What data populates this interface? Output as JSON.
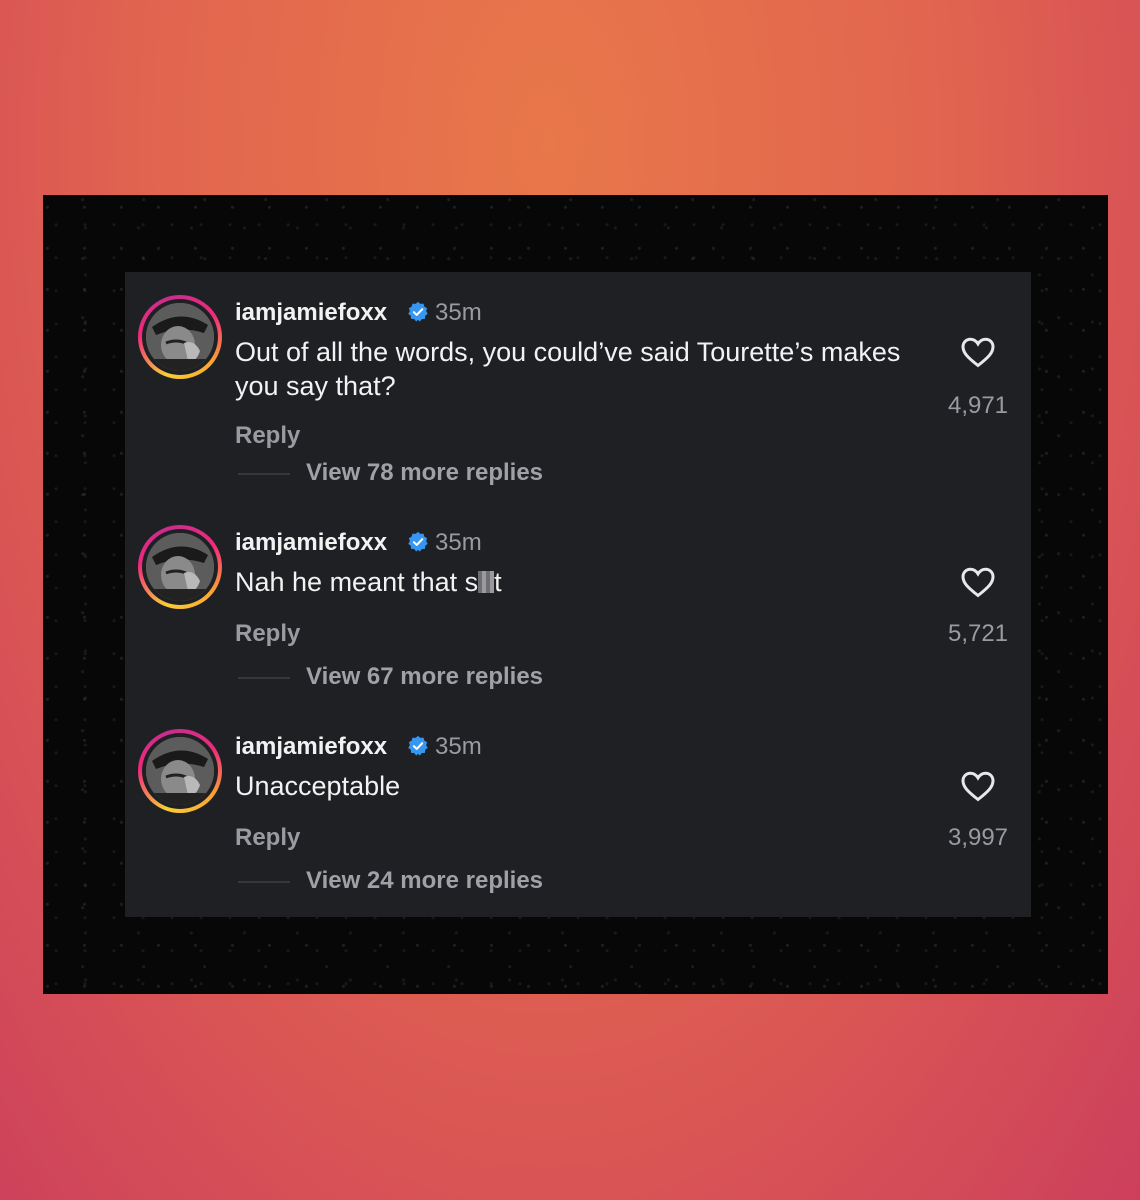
{
  "comments": [
    {
      "username": "iamjamiefoxx",
      "time": "35m",
      "text": "Out of all the words, you could’ve said Tourette’s makes you say that?",
      "reply_label": "Reply",
      "view_replies_label": "View 78 more replies",
      "likes": "4,971"
    },
    {
      "username": "iamjamiefoxx",
      "time": "35m",
      "text_before_censor": "Nah he meant that s",
      "text_after_censor": "t",
      "reply_label": "Reply",
      "view_replies_label": "View 67 more replies",
      "likes": "5,721"
    },
    {
      "username": "iamjamiefoxx",
      "time": "35m",
      "text": "Unacceptable",
      "reply_label": "Reply",
      "view_replies_label": "View 24 more replies",
      "likes": "3,997"
    }
  ],
  "colors": {
    "verified_badge": "#3797f0",
    "panel_background": "#1f2024",
    "secondary_text": "#9a9ba1"
  },
  "icons": {
    "verified": "verified-badge-icon",
    "like": "heart-outline-icon"
  }
}
